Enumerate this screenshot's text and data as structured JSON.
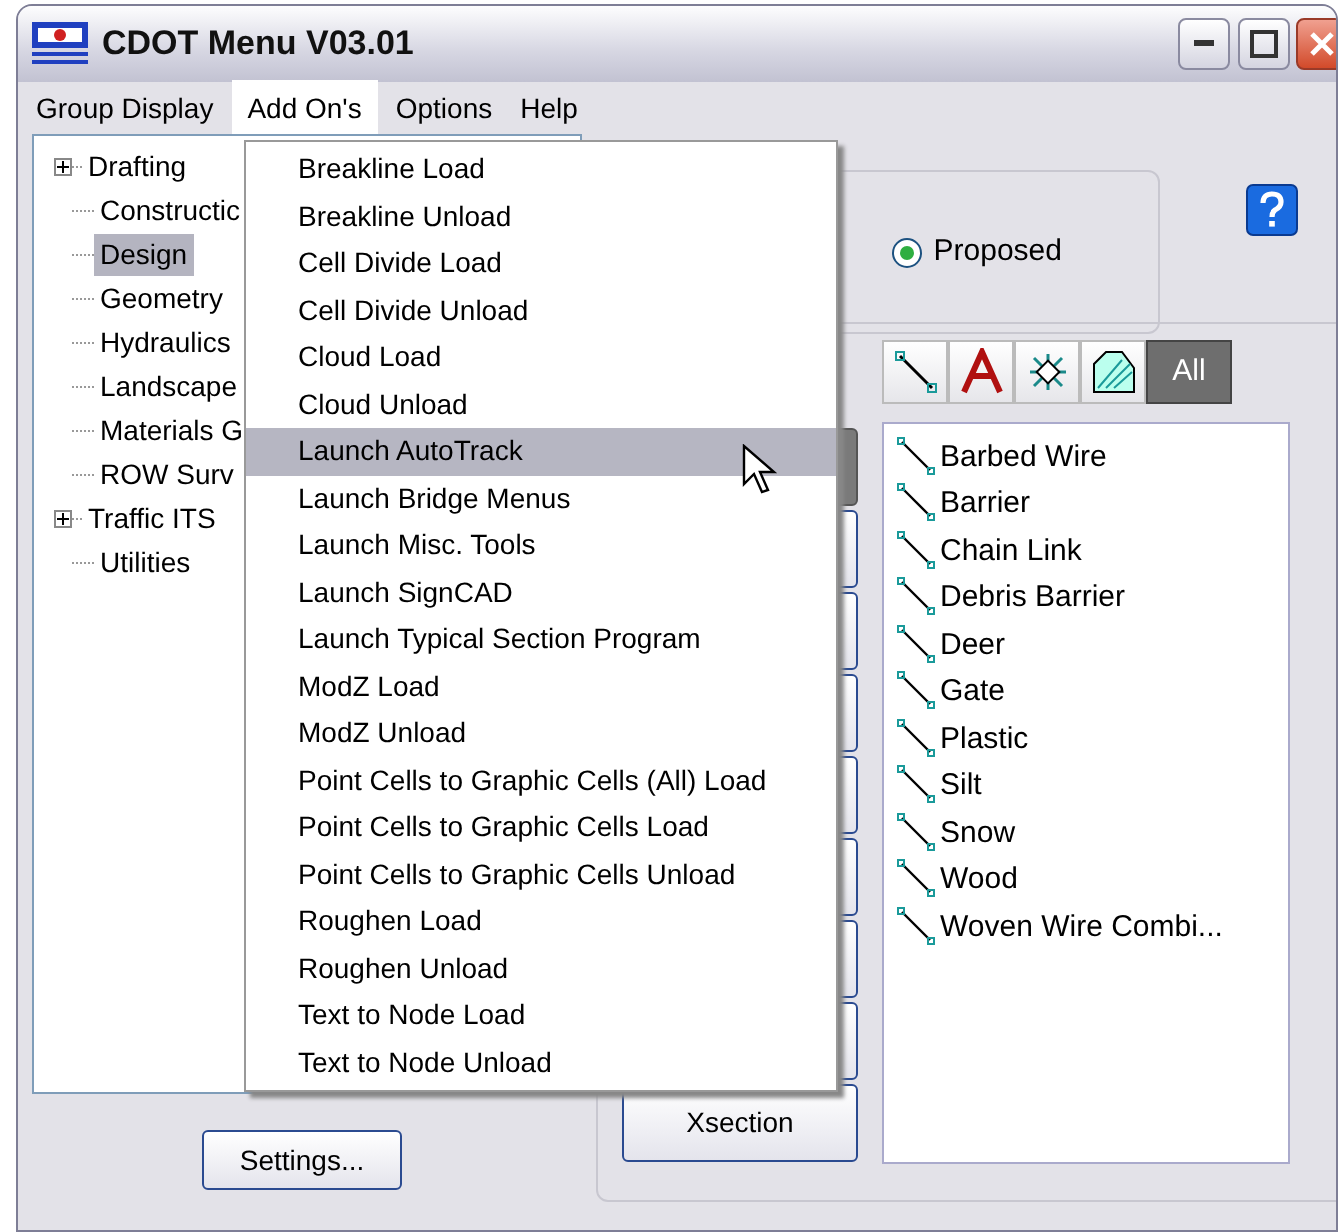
{
  "window": {
    "title": "CDOT Menu V03.01"
  },
  "menu_bar": [
    {
      "label": "Group Display",
      "selected": false
    },
    {
      "label": "Add On's",
      "selected": true
    },
    {
      "label": "Options",
      "selected": false
    },
    {
      "label": "Help",
      "selected": false
    }
  ],
  "tree": [
    {
      "label": "Drafting",
      "kind": "group",
      "expanded": false,
      "selected": false
    },
    {
      "label": "Constructic",
      "kind": "leaf",
      "selected": false
    },
    {
      "label": "Design",
      "kind": "leaf",
      "selected": true
    },
    {
      "label": "Geometry",
      "kind": "leaf",
      "selected": false
    },
    {
      "label": "Hydraulics",
      "kind": "leaf",
      "selected": false
    },
    {
      "label": "Landscape",
      "kind": "leaf",
      "selected": false
    },
    {
      "label": "Materials G",
      "kind": "leaf",
      "selected": false
    },
    {
      "label": "ROW Surv",
      "kind": "leaf",
      "selected": false
    },
    {
      "label": "Traffic ITS",
      "kind": "group",
      "expanded": false,
      "selected": false
    },
    {
      "label": "Utilities",
      "kind": "leaf",
      "selected": false
    }
  ],
  "settings_button": "Settings...",
  "dropdown": [
    {
      "label": "Breakline Load",
      "selected": false
    },
    {
      "label": "Breakline Unload",
      "selected": false
    },
    {
      "label": "Cell Divide Load",
      "selected": false
    },
    {
      "label": "Cell Divide Unload",
      "selected": false
    },
    {
      "label": "Cloud Load",
      "selected": false
    },
    {
      "label": "Cloud Unload",
      "selected": false
    },
    {
      "label": "Launch AutoTrack",
      "selected": true
    },
    {
      "label": "Launch Bridge Menus",
      "selected": false
    },
    {
      "label": "Launch Misc. Tools",
      "selected": false
    },
    {
      "label": "Launch SignCAD",
      "selected": false
    },
    {
      "label": "Launch Typical Section Program",
      "selected": false
    },
    {
      "label": "ModZ Load",
      "selected": false
    },
    {
      "label": "ModZ Unload",
      "selected": false
    },
    {
      "label": "Point Cells to Graphic Cells (All) Load",
      "selected": false
    },
    {
      "label": "Point Cells to Graphic Cells Load",
      "selected": false
    },
    {
      "label": "Point Cells to Graphic Cells Unload",
      "selected": false
    },
    {
      "label": "Roughen Load",
      "selected": false
    },
    {
      "label": "Roughen Unload",
      "selected": false
    },
    {
      "label": "Text to Node Load",
      "selected": false
    },
    {
      "label": "Text to Node Unload",
      "selected": false
    }
  ],
  "phase_radio": {
    "label": "Proposed",
    "selected": true
  },
  "side_buttons": [
    {
      "selected": true
    },
    {
      "selected": false
    },
    {
      "selected": false
    },
    {
      "selected": false
    },
    {
      "selected": false
    },
    {
      "selected": false
    },
    {
      "selected": false
    },
    {
      "selected": false
    },
    {
      "label": "Xsection",
      "selected": false
    }
  ],
  "category_toolbar": [
    {
      "kind": "line",
      "selected": false
    },
    {
      "kind": "text",
      "selected": false
    },
    {
      "kind": "point",
      "selected": false
    },
    {
      "kind": "pattern",
      "selected": false
    },
    {
      "kind": "all",
      "label": "All",
      "selected": true
    }
  ],
  "item_list": [
    {
      "label": "Barbed Wire"
    },
    {
      "label": "Barrier"
    },
    {
      "label": "Chain Link"
    },
    {
      "label": "Debris Barrier"
    },
    {
      "label": "Deer"
    },
    {
      "label": "Gate"
    },
    {
      "label": "Plastic"
    },
    {
      "label": "Silt"
    },
    {
      "label": "Snow"
    },
    {
      "label": "Wood"
    },
    {
      "label": "Woven Wire Combi..."
    }
  ]
}
